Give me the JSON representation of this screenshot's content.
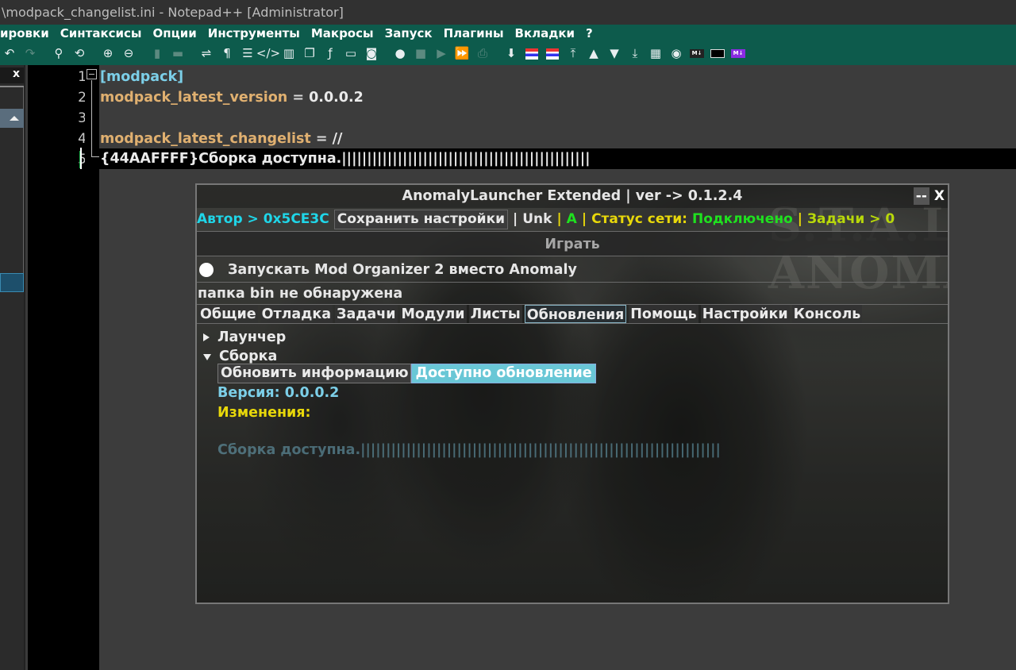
{
  "window": {
    "title": "\\modpack_changelist.ini - Notepad++ [Administrator]"
  },
  "menu": [
    "ировки",
    "Синтаксисы",
    "Опции",
    "Инструменты",
    "Макросы",
    "Запуск",
    "Плагины",
    "Вкладки",
    "?"
  ],
  "toolbar_icons": [
    "undo-icon",
    "redo-icon",
    "find-icon",
    "replace-icon",
    "zoom-in-icon",
    "zoom-out-icon",
    "sync-v-icon",
    "sync-h-icon",
    "word-wrap-icon",
    "show-all-chars-icon",
    "indent-guide-icon",
    "xml-tag-icon",
    "doc-map-icon",
    "doc-list-icon",
    "function-list-icon",
    "monitor-icon",
    "screenshot-icon",
    "record-macro-icon",
    "stop-macro-icon",
    "play-macro-icon",
    "run-macro-multiple-icon",
    "save-macro-icon",
    "bookmark-icon",
    "compare-icon",
    "clear-compare-icon",
    "first-diff-icon",
    "prev-diff-icon",
    "next-diff-icon",
    "last-diff-icon",
    "diff-nav-icon",
    "settings-icon",
    "md-icon",
    "console-icon",
    "md-purple-icon"
  ],
  "left_panel": {
    "close": "x"
  },
  "editor": {
    "line_numbers": [
      "1",
      "2",
      "3",
      "4",
      "5"
    ],
    "lines": [
      {
        "section": "[modpack]"
      },
      {
        "key": "modpack_latest_version",
        "op": " = ",
        "value": "0.0.0.2"
      },
      {
        "text": ""
      },
      {
        "key": "modpack_latest_changelist",
        "op": " = ",
        "value": "//"
      },
      {
        "value": "{44AAFFFF}Сборка доступна.|||||||||||||||||||||||||||||||||||||||||||||||||"
      }
    ]
  },
  "launcher": {
    "title": "AnomalyLauncher Extended | ver -> 0.1.2.4",
    "minimize": "--",
    "close": "X",
    "background_text": "S.T.A.L.K.E.R\nANOMALY",
    "status": {
      "author": "Автор > 0x5CE3C",
      "save_button": "Сохранить настройки",
      "sep1": "|",
      "unk": "Unk",
      "sep2": "|",
      "a": "A",
      "sep3": "|",
      "net_label": "Статус сети:",
      "net_value": "Подключено",
      "sep4": "|",
      "tasks": "Задачи > 0"
    },
    "play": "Играть",
    "mo2_option": "Запускать Mod Organizer 2 вместо Anomaly",
    "bin_message": "папка bin не обнаружена",
    "tabs": [
      "Общие",
      "Отладка",
      "Задачи",
      "Модули",
      "Листы",
      "Обновления",
      "Помощь",
      "Настройки",
      "Консоль"
    ],
    "active_tab": "Обновления",
    "tree": {
      "launcher": "Лаунчер",
      "modpack": "Сборка"
    },
    "update_button": "Обновить информацию",
    "available_button": "Доступно обновление",
    "version": "Версия: 0.0.0.2",
    "changes": "Изменения:",
    "changelog": "Сборка доступна.|||||||||||||||||||||||||||||||||||||||||||||||||||||||||||||||||||||||"
  },
  "colors": {
    "menu_bg": "#0d5b4c",
    "section": "#7ccfe8",
    "key": "#e0b070",
    "cyan": "#1fd6e8",
    "yellow": "#e8d80a",
    "green": "#1fe11f",
    "active_update": "#69c7d6"
  }
}
